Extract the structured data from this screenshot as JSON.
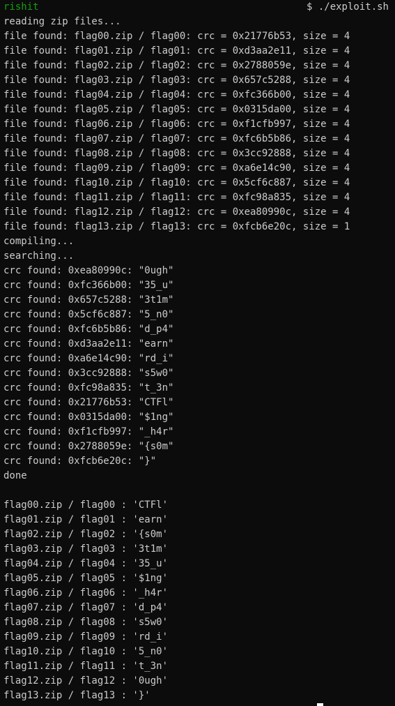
{
  "prompt": {
    "user": "rishit",
    "command": "$ ./exploit.sh"
  },
  "colors": {
    "background": "#0c0c0c",
    "text": "#cccccc",
    "user": "#13a10e"
  },
  "output_lines": [
    "reading zip files...",
    "file found: flag00.zip / flag00: crc = 0x21776b53, size = 4",
    "file found: flag01.zip / flag01: crc = 0xd3aa2e11, size = 4",
    "file found: flag02.zip / flag02: crc = 0x2788059e, size = 4",
    "file found: flag03.zip / flag03: crc = 0x657c5288, size = 4",
    "file found: flag04.zip / flag04: crc = 0xfc366b00, size = 4",
    "file found: flag05.zip / flag05: crc = 0x0315da00, size = 4",
    "file found: flag06.zip / flag06: crc = 0xf1cfb997, size = 4",
    "file found: flag07.zip / flag07: crc = 0xfc6b5b86, size = 4",
    "file found: flag08.zip / flag08: crc = 0x3cc92888, size = 4",
    "file found: flag09.zip / flag09: crc = 0xa6e14c90, size = 4",
    "file found: flag10.zip / flag10: crc = 0x5cf6c887, size = 4",
    "file found: flag11.zip / flag11: crc = 0xfc98a835, size = 4",
    "file found: flag12.zip / flag12: crc = 0xea80990c, size = 4",
    "file found: flag13.zip / flag13: crc = 0xfcb6e20c, size = 1",
    "compiling...",
    "searching...",
    "crc found: 0xea80990c: \"0ugh\"",
    "crc found: 0xfc366b00: \"35_u\"",
    "crc found: 0x657c5288: \"3t1m\"",
    "crc found: 0x5cf6c887: \"5_n0\"",
    "crc found: 0xfc6b5b86: \"d_p4\"",
    "crc found: 0xd3aa2e11: \"earn\"",
    "crc found: 0xa6e14c90: \"rd_i\"",
    "crc found: 0x3cc92888: \"s5w0\"",
    "crc found: 0xfc98a835: \"t_3n\"",
    "crc found: 0x21776b53: \"CTFl\"",
    "crc found: 0x0315da00: \"$1ng\"",
    "crc found: 0xf1cfb997: \"_h4r\"",
    "crc found: 0x2788059e: \"{s0m\"",
    "crc found: 0xfcb6e20c: \"}\"",
    "done",
    "",
    "flag00.zip / flag00 : 'CTFl'",
    "flag01.zip / flag01 : 'earn'",
    "flag02.zip / flag02 : '{s0m'",
    "flag03.zip / flag03 : '3t1m'",
    "flag04.zip / flag04 : '35_u'",
    "flag05.zip / flag05 : '$1ng'",
    "flag06.zip / flag06 : '_h4r'",
    "flag07.zip / flag07 : 'd_p4'",
    "flag08.zip / flag08 : 's5w0'",
    "flag09.zip / flag09 : 'rd_i'",
    "flag10.zip / flag10 : '5_n0'",
    "flag11.zip / flag11 : 't_3n'",
    "flag12.zip / flag12 : '0ugh'",
    "flag13.zip / flag13 : '}'"
  ]
}
